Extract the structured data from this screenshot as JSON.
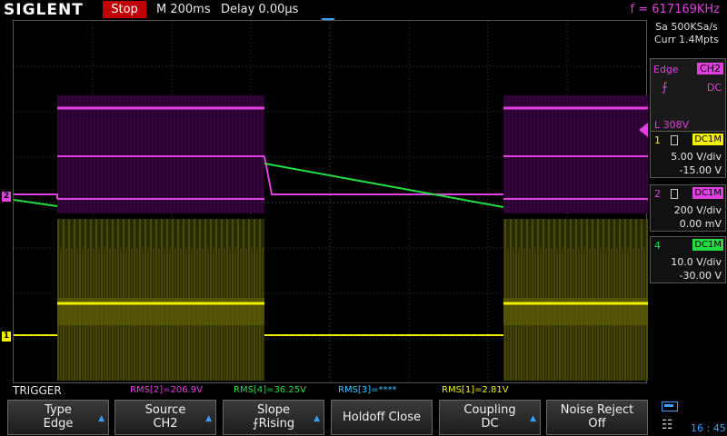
{
  "topbar": {
    "brand": "SIGLENT",
    "run_state": "Stop",
    "timebase": "M 200ms",
    "delay": "Delay 0.00µs",
    "frequency": "f = 617169KHz"
  },
  "acquisition": {
    "sample_rate": "Sa 500KSa/s",
    "memory_depth": "Curr 1.4Mpts"
  },
  "trigger_panel": {
    "type": "Edge",
    "source": "CH2",
    "slope_icon": "rising-edge-icon",
    "coupling": "DC",
    "level": "L  308V"
  },
  "channels": [
    {
      "num": "1",
      "coupling": "DC1M",
      "vdiv": "5.00 V/div",
      "offset": "-15.00 V",
      "color": "#f0f000"
    },
    {
      "num": "2",
      "coupling": "DC1M",
      "vdiv": "200 V/div",
      "offset": "0.00 mV",
      "color": "#e040e0"
    },
    {
      "num": "4",
      "coupling": "DC1M",
      "vdiv": "10.0 V/div",
      "offset": "-30.00 V",
      "color": "#22dd44"
    }
  ],
  "channel_markers": {
    "ch2": "2",
    "ch1": "1"
  },
  "measurements": {
    "menu_title": "TRIGGER",
    "rms2": "RMS[2]=206.9V",
    "rms4": "RMS[4]=36.25V",
    "rms3": "RMS[3]=****",
    "rms1": "RMS[1]=2.81V"
  },
  "softkeys": [
    {
      "line1": "Type",
      "line2": "Edge",
      "arrow": true
    },
    {
      "line1": "Source",
      "line2": "CH2",
      "arrow": true
    },
    {
      "line1": "Slope",
      "line2": "Rising",
      "arrow": true,
      "icon": "rising-edge-icon"
    },
    {
      "line1": "Holdoff Close",
      "line2": "",
      "arrow": false
    },
    {
      "line1": "Coupling",
      "line2": "DC",
      "arrow": true
    },
    {
      "line1": "Noise Reject",
      "line2": "Off",
      "arrow": false
    }
  ],
  "status": {
    "clock": "16 : 45"
  }
}
